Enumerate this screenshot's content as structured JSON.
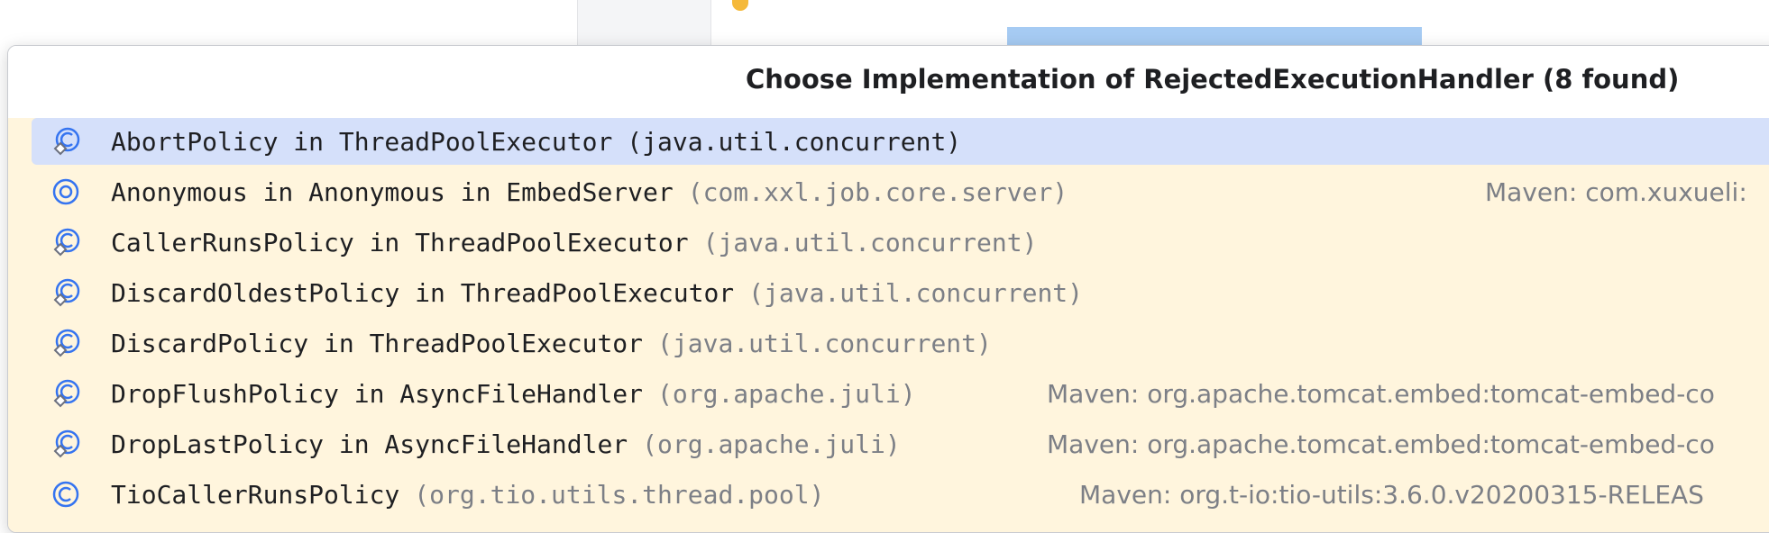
{
  "editor": {
    "colors": {
      "selection": "#a6cbf3",
      "bulb": "#f5b93a"
    }
  },
  "popup": {
    "title": "Choose Implementation of RejectedExecutionHandler (8 found)",
    "colors": {
      "list_bg": "#fff5dd",
      "selected_bg": "#d5e0fa",
      "icon": "#3574f0"
    },
    "items": [
      {
        "name": "AbortPolicy in ThreadPoolExecutor",
        "package": "(java.util.concurrent)",
        "maven": "",
        "icon": "inner-class-icon",
        "selected": true
      },
      {
        "name": "Anonymous in Anonymous in EmbedServer",
        "package": "(com.xxl.job.core.server)",
        "maven": "Maven: com.xuxueli:",
        "icon": "anonymous-class-icon",
        "selected": false
      },
      {
        "name": "CallerRunsPolicy in ThreadPoolExecutor",
        "package": "(java.util.concurrent)",
        "maven": "",
        "icon": "inner-class-icon",
        "selected": false
      },
      {
        "name": "DiscardOldestPolicy in ThreadPoolExecutor",
        "package": "(java.util.concurrent)",
        "maven": "",
        "icon": "inner-class-icon",
        "selected": false
      },
      {
        "name": "DiscardPolicy in ThreadPoolExecutor",
        "package": "(java.util.concurrent)",
        "maven": "",
        "icon": "inner-class-icon",
        "selected": false
      },
      {
        "name": "DropFlushPolicy in AsyncFileHandler",
        "package": "(org.apache.juli)",
        "maven": "Maven: org.apache.tomcat.embed:tomcat-embed-co",
        "icon": "inner-class-icon",
        "selected": false
      },
      {
        "name": "DropLastPolicy in AsyncFileHandler",
        "package": "(org.apache.juli)",
        "maven": "Maven: org.apache.tomcat.embed:tomcat-embed-co",
        "icon": "inner-class-icon",
        "selected": false
      },
      {
        "name": "TioCallerRunsPolicy",
        "package": "(org.tio.utils.thread.pool)",
        "maven": "Maven: org.t-io:tio-utils:3.6.0.v20200315-RELEAS",
        "icon": "class-icon",
        "selected": false
      }
    ]
  }
}
